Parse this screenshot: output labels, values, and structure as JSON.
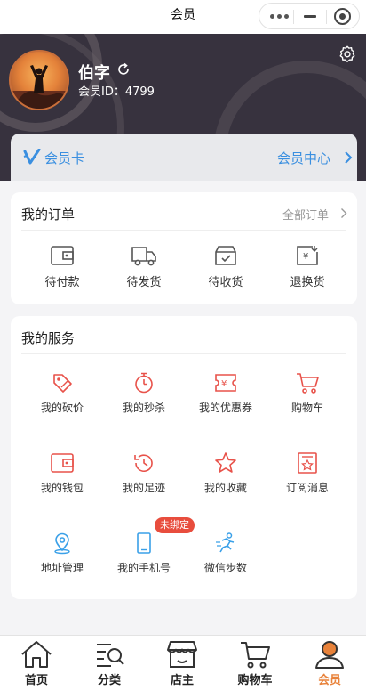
{
  "titlebar": {
    "title": "会员"
  },
  "profile": {
    "username": "伯字",
    "member_id": "会员ID：4799"
  },
  "member_card": {
    "label": "会员卡",
    "center_link": "会员中心"
  },
  "orders": {
    "title": "我的订单",
    "all_link": "全部订单",
    "items": [
      {
        "label": "待付款",
        "icon": "wallet-icon"
      },
      {
        "label": "待发货",
        "icon": "truck-icon"
      },
      {
        "label": "待收货",
        "icon": "box-icon"
      },
      {
        "label": "退换货",
        "icon": "refund-icon"
      }
    ]
  },
  "services": {
    "title": "我的服务",
    "items": [
      {
        "label": "我的砍价",
        "icon": "tag-cut-icon"
      },
      {
        "label": "我的秒杀",
        "icon": "stopwatch-icon"
      },
      {
        "label": "我的优惠券",
        "icon": "coupon-icon"
      },
      {
        "label": "购物车",
        "icon": "cart-icon"
      },
      {
        "label": "我的钱包",
        "icon": "wallet-icon"
      },
      {
        "label": "我的足迹",
        "icon": "history-icon"
      },
      {
        "label": "我的收藏",
        "icon": "star-icon"
      },
      {
        "label": "订阅消息",
        "icon": "subscribe-icon"
      },
      {
        "label": "地址管理",
        "icon": "location-icon"
      },
      {
        "label": "我的手机号",
        "icon": "phone-icon"
      },
      {
        "label": "微信步数",
        "icon": "running-icon"
      }
    ],
    "phone_badge": "未绑定"
  },
  "tabbar": {
    "tabs": [
      {
        "label": "首页",
        "icon": "home-icon"
      },
      {
        "label": "分类",
        "icon": "category-search-icon"
      },
      {
        "label": "店主",
        "icon": "store-icon"
      },
      {
        "label": "购物车",
        "icon": "cart-icon"
      },
      {
        "label": "会员",
        "icon": "user-icon"
      }
    ],
    "active_index": 4
  },
  "colors": {
    "header_bg": "#37323e",
    "accent_blue": "#3a8fe0",
    "service_red": "#e8524a",
    "service_blue": "#3aa0e8",
    "tab_active": "#e8823a",
    "badge_red": "#e84d3d"
  }
}
